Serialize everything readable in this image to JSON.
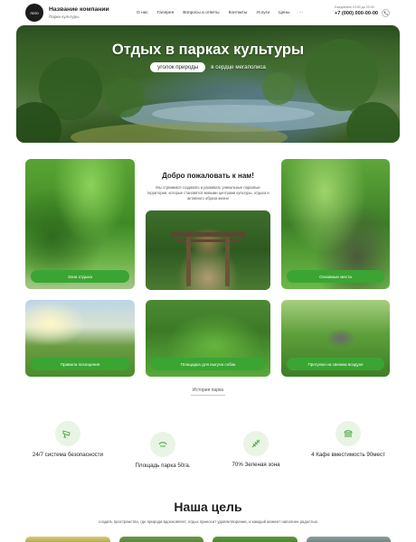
{
  "header": {
    "logo_text": "лого",
    "company_name": "Название компании",
    "company_sub": "Парки культуры",
    "nav": [
      "О нас",
      "Галерея",
      "Вопросы и ответы",
      "Контакты",
      "Услуги",
      "Цены",
      "···"
    ],
    "hours": "Ежедневно 10:00 до 22:00",
    "phone": "+7 (000) 000-00-00",
    "call_icon": "phone-icon"
  },
  "hero": {
    "title": "Отдых в парках культуры",
    "pill": "уголок природы",
    "rest": "в сердце мегаполиса"
  },
  "welcome": {
    "title": "Добро пожаловать к нам!",
    "text": "Мы стремимся создавать и развивать уникальные парковые территории, которые становятся живыми центрами культуры, отдыха и активного образа жизни"
  },
  "cards": [
    {
      "button": "Зона отдыха"
    },
    {
      "button": "Основные места"
    },
    {
      "button": "Правила посещения"
    },
    {
      "button": "Площадка для выгула собак"
    },
    {
      "button": "Прогулки на свежем воздухе"
    }
  ],
  "history_label": "История парка",
  "stats": [
    {
      "icon": "camera-icon",
      "label": "24/7 система безопасности"
    },
    {
      "icon": "area-icon",
      "label": "Площадь парка 50га."
    },
    {
      "icon": "tree-icon",
      "label": "70%  Зеленая зона"
    },
    {
      "icon": "burger-icon",
      "label": "4 Кафе вместимость 90мест"
    }
  ],
  "goal": {
    "title": "Наша цель",
    "text": "создать пространство, где природа вдохновляет, отдых приносит удовлетворение, и каждый момент наполнен радостью"
  },
  "colors": {
    "accent": "#3aa533",
    "icon_bg": "#e9f4e5"
  }
}
